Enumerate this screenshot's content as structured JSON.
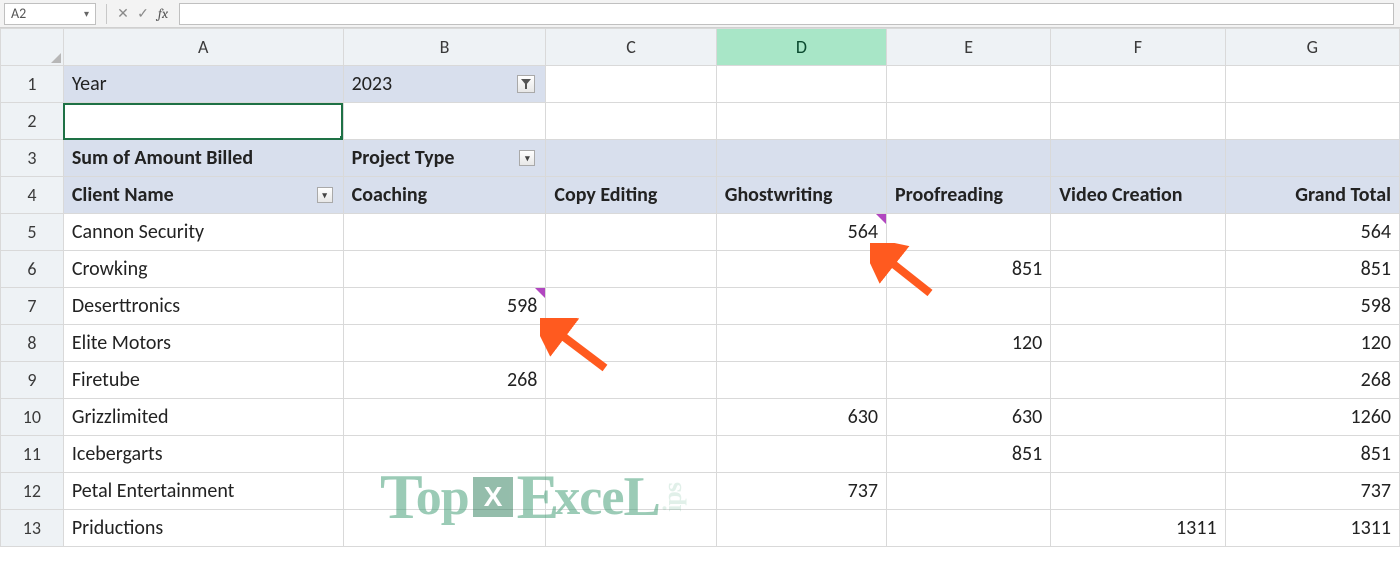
{
  "formula_bar": {
    "name_box": "A2",
    "cancel_glyph": "✕",
    "confirm_glyph": "✓",
    "fx_label": "fx",
    "formula_value": ""
  },
  "columns": [
    "A",
    "B",
    "C",
    "D",
    "E",
    "F",
    "G"
  ],
  "highlight_col_index": 3,
  "row_numbers": [
    "1",
    "2",
    "3",
    "4",
    "5",
    "6",
    "7",
    "8",
    "9",
    "10",
    "11",
    "12",
    "13"
  ],
  "pivot": {
    "filter_field": "Year",
    "filter_value": "2023",
    "data_field_label": "Sum of Amount Billed",
    "columns_field_label": "Project Type",
    "rows_field_label": "Client Name",
    "column_labels": [
      "Coaching",
      "Copy Editing",
      "Ghostwriting",
      "Proofreading",
      "Video Creation",
      "Grand Total"
    ],
    "rows": [
      {
        "name": "Cannon Security",
        "values": [
          "",
          "",
          "564",
          "",
          "",
          "564"
        ],
        "note_col": 2
      },
      {
        "name": "Crowking",
        "values": [
          "",
          "",
          "",
          "851",
          "",
          "851"
        ]
      },
      {
        "name": "Deserttronics",
        "values": [
          "598",
          "",
          "",
          "",
          "",
          "598"
        ],
        "note_col": 0
      },
      {
        "name": "Elite Motors",
        "values": [
          "",
          "",
          "",
          "120",
          "",
          "120"
        ]
      },
      {
        "name": "Firetube",
        "values": [
          "268",
          "",
          "",
          "",
          "",
          "268"
        ]
      },
      {
        "name": "Grizzlimited",
        "values": [
          "",
          "",
          "630",
          "630",
          "",
          "1260"
        ]
      },
      {
        "name": "Icebergarts",
        "values": [
          "",
          "",
          "",
          "851",
          "",
          "851"
        ]
      },
      {
        "name": "Petal Entertainment",
        "values": [
          "",
          "",
          "737",
          "",
          "",
          "737"
        ]
      },
      {
        "name": "Priductions",
        "values": [
          "",
          "",
          "",
          "",
          "1311",
          "1311"
        ]
      }
    ]
  },
  "watermark_text": "Top Excel Tips"
}
